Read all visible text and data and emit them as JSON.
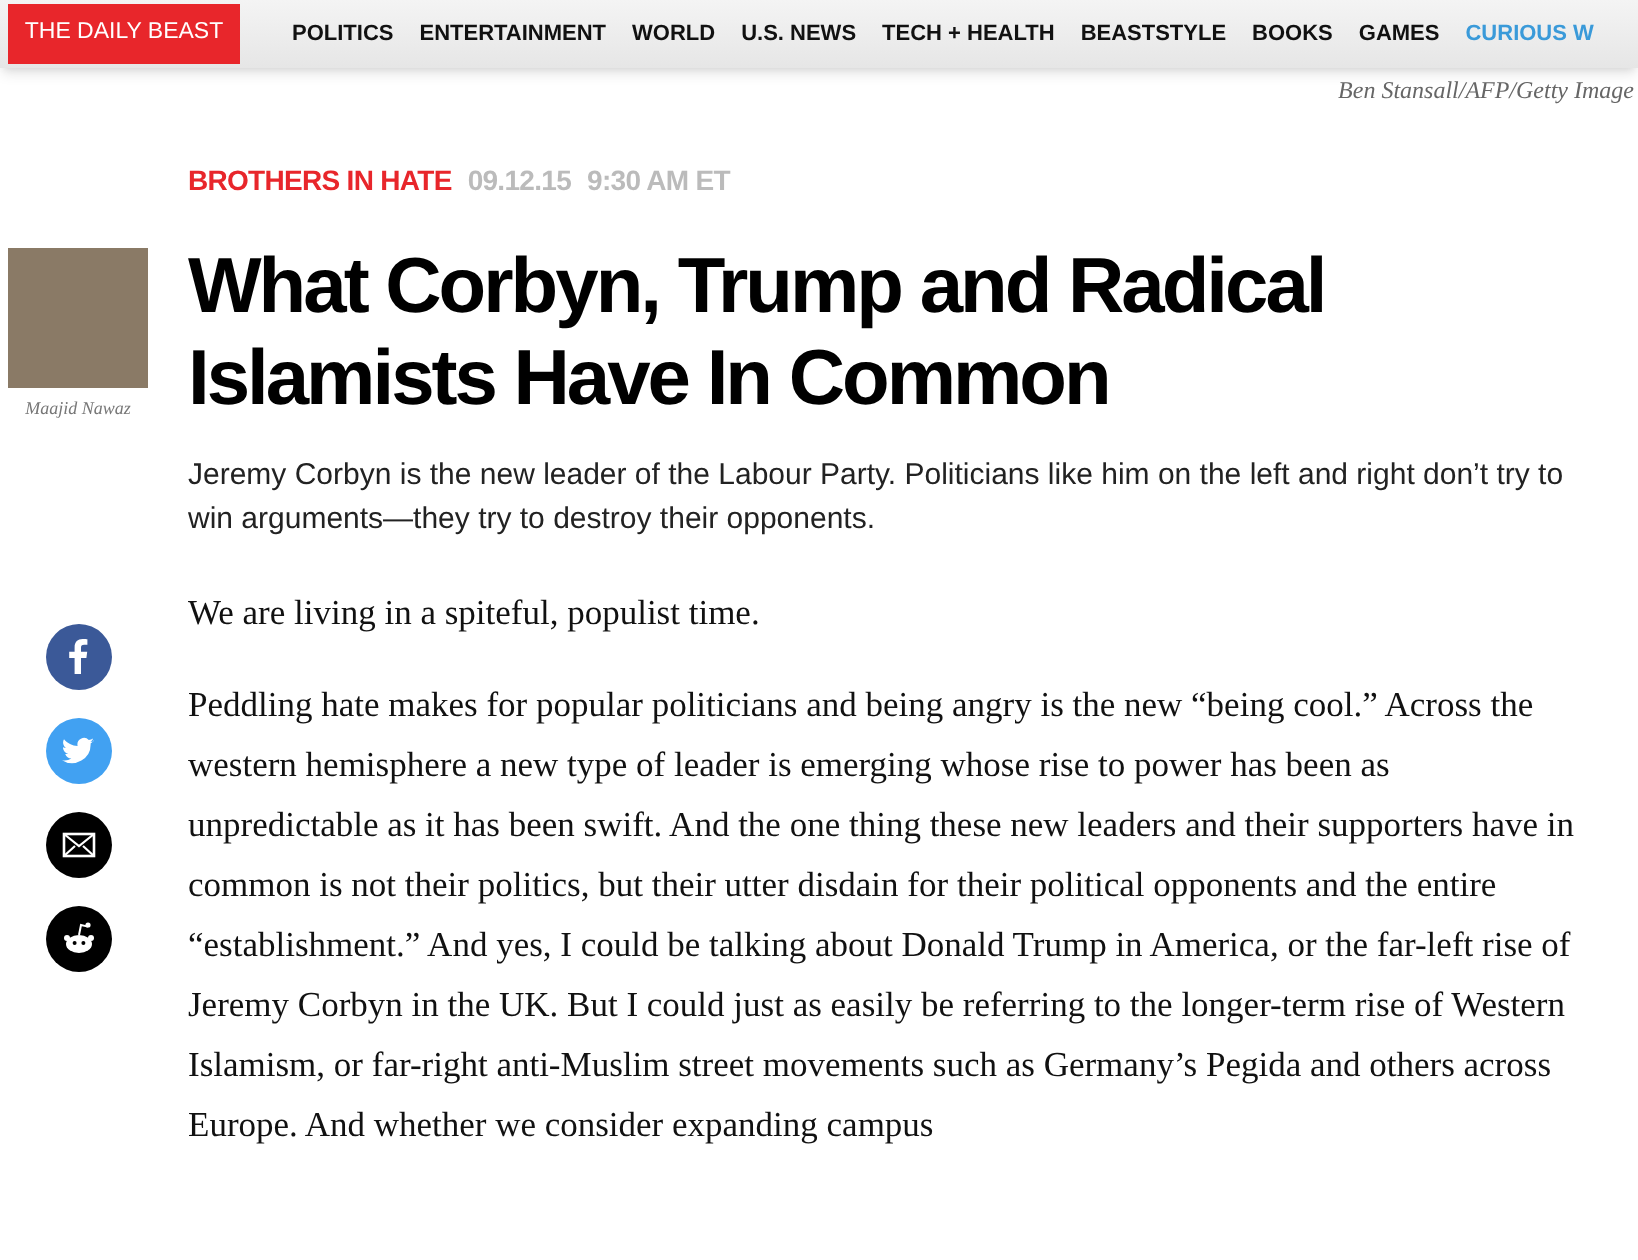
{
  "nav": {
    "logo": "THE DAILY BEAST",
    "items": [
      {
        "label": "POLITICS",
        "highlighted": false
      },
      {
        "label": "ENTERTAINMENT",
        "highlighted": false
      },
      {
        "label": "WORLD",
        "highlighted": false
      },
      {
        "label": "U.S. NEWS",
        "highlighted": false
      },
      {
        "label": "TECH + HEALTH",
        "highlighted": false
      },
      {
        "label": "BEASTSTYLE",
        "highlighted": false
      },
      {
        "label": "BOOKS",
        "highlighted": false
      },
      {
        "label": "GAMES",
        "highlighted": false
      },
      {
        "label": "CURIOUS W",
        "highlighted": true
      }
    ]
  },
  "photo_credit": "Ben Stansall/AFP/Getty Image",
  "article": {
    "kicker": "BROTHERS IN HATE",
    "date": "09.12.15",
    "time": "9:30 AM ET",
    "author": "Maajid Nawaz",
    "headline": "What Corbyn, Trump and Radical Islamists Have In Common",
    "dek": "Jeremy Corbyn is the new leader of the Labour Party. Politicians like him on the left and right don’t try to win arguments—they try to destroy their opponents.",
    "paragraphs": [
      "We are living in a spiteful, populist time.",
      "Peddling hate makes for popular politicians and being angry is the new “being cool.” Across the western hemisphere a new type of leader is emerging whose rise to power has been as unpredictable as it has been swift. And the one thing these new leaders and their supporters have in common is not their politics, but their utter disdain for their political opponents and the entire “establishment.” And yes, I could be talking about Donald Trump in America, or the far-left rise of Jeremy Corbyn in the UK. But I could just as easily be referring to the longer-term rise of Western Islamism, or far-right anti-Muslim street movements such as Germany’s Pegida and others across Europe. And whether we consider expanding campus"
    ]
  },
  "share": [
    {
      "kind": "facebook"
    },
    {
      "kind": "twitter"
    },
    {
      "kind": "email"
    },
    {
      "kind": "reddit"
    }
  ]
}
